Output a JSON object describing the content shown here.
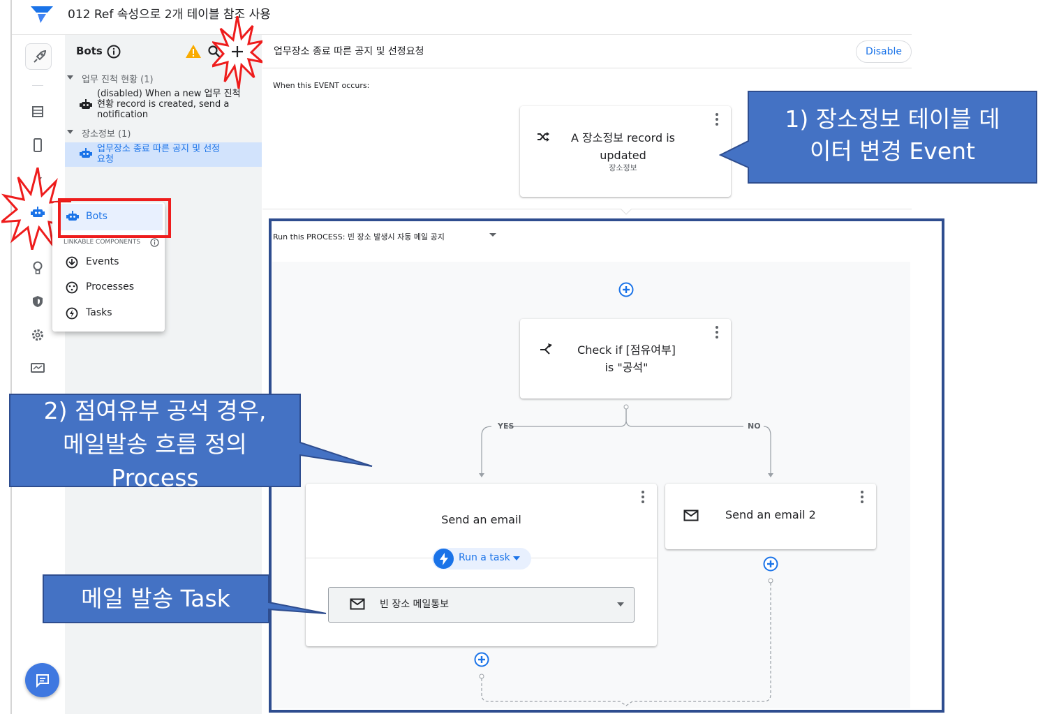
{
  "app": {
    "title": "012 Ref 속성으로 2개 테이블 참조 사용"
  },
  "bots_panel": {
    "title": "Bots",
    "groups": [
      {
        "label": "업무 진척 현황 (1)",
        "items": [
          {
            "line1": "(disabled) When a new 업무 진척",
            "line2": "현황 record is created, send a",
            "line3": "notification"
          }
        ]
      },
      {
        "label": "장소정보 (1)",
        "items": [
          {
            "line1": "업무장소 종료 따른 공지 및 선정",
            "line2": "요청"
          }
        ]
      }
    ]
  },
  "menu": {
    "bots_label": "Bots",
    "section_label": "LINKABLE COMPONENTS",
    "items": [
      {
        "label": "Events"
      },
      {
        "label": "Processes"
      },
      {
        "label": "Tasks"
      }
    ]
  },
  "main": {
    "bot_name": "업무장소 종료 따른 공지 및 선정요청",
    "disable_label": "Disable",
    "event_label": "When this EVENT occurs:",
    "event_card": {
      "line1": "A 장소정보 record is",
      "line2": "updated",
      "table": "장소정보"
    },
    "process_label": "Run this PROCESS:  빈 장소 발생시 자동 메일 공지",
    "condition_card": {
      "line1": "Check if [점유여부]",
      "line2": "is \"공석\""
    },
    "branch_yes": "YES",
    "branch_no": "NO",
    "email_card": {
      "title": "Send an email",
      "run_task_label": "Run a task",
      "task_value": "빈 장소 메일통보"
    },
    "email2_card": {
      "title": "Send an email 2"
    }
  },
  "callouts": {
    "event": {
      "line1": "1) 장소정보 테이블 데",
      "line2": "이터 변경 Event"
    },
    "process": {
      "line1": "2) 점여유부 공석 경우,",
      "line2": "메일발송 흐름 정의",
      "line3": "Process"
    },
    "task": {
      "line1": "메일 발송 Task"
    }
  },
  "colors": {
    "accent": "#1a73e8",
    "callout_fill": "#4472c4",
    "callout_border": "#2e4d8f",
    "highlight_red": "#ee1c1c",
    "warning": "#f9ab00"
  },
  "icons": {
    "logo": "appsheet-logo-icon",
    "rail": [
      "rocket-icon",
      "table-icon",
      "phone-icon",
      "bolt-icon",
      "robot-icon",
      "lightbulb-icon",
      "shield-icon",
      "gear-icon",
      "monitor-icon"
    ],
    "chat": "chat-icon"
  }
}
